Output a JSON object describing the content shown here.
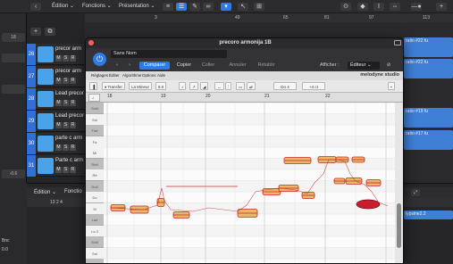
{
  "logic": {
    "menu": [
      "Édition ⌄",
      "Fonctions ⌄",
      "Présentation ⌄"
    ],
    "ruler_marks": [
      "3",
      "49",
      "65",
      "81",
      "97",
      "113"
    ],
    "inspector_value": "18",
    "bottom_values": [
      "Bnc",
      "0.0",
      "-0.6"
    ]
  },
  "tracks": [
    {
      "num": "26",
      "name": "precor arm"
    },
    {
      "num": "27",
      "name": "precor arm"
    },
    {
      "num": "28",
      "name": "Lead precor"
    },
    {
      "num": "29",
      "name": "Lead precor"
    },
    {
      "num": "30",
      "name": "parte c arm"
    },
    {
      "num": "31",
      "name": "Parte c arm"
    }
  ],
  "track_buttons": [
    "M",
    "S",
    "R"
  ],
  "regions": [
    "ratio #22 fu",
    "ratio #22 fu",
    "ratio #19 fu",
    "ratio #17 fu"
  ],
  "lower": {
    "labels": [
      "Édition ⌄",
      "Fonctio"
    ],
    "position": "13 2 4",
    "region_name": "lypsine2.2"
  },
  "plugin": {
    "title": "precoro armonija 1B",
    "preset": "Sans Nom",
    "buttons": [
      "Comparer",
      "Copier",
      "Coller",
      "Annuler",
      "Rétablir"
    ],
    "afficher_label": "Afficher :",
    "view_select": "Éditeur ⌄",
    "logo": "melodyne studio",
    "menu": [
      "Réglages",
      "Éditer",
      "Algorithme",
      "Options",
      "Aide"
    ],
    "tools": [
      "♦ Transfer",
      "La Mineur",
      "8.0",
      "Do 4",
      "+4 ct"
    ],
    "bars": [
      "18",
      "19",
      "20",
      "21",
      "22"
    ],
    "keys": [
      "Sol#",
      "Sol",
      "Fa#",
      "Fa",
      "Mi",
      "Ré#",
      "Ré",
      "Do#",
      "Do",
      "Si",
      "La#",
      "La 3",
      "Sol#",
      "Sol",
      "Fa#"
    ]
  },
  "colors": {
    "accent": "#2f7ae5",
    "region": "#3f7fd6",
    "blob_fill": "#e8b86a",
    "blob_line": "#c62828",
    "note_active": "#c81d2e"
  }
}
